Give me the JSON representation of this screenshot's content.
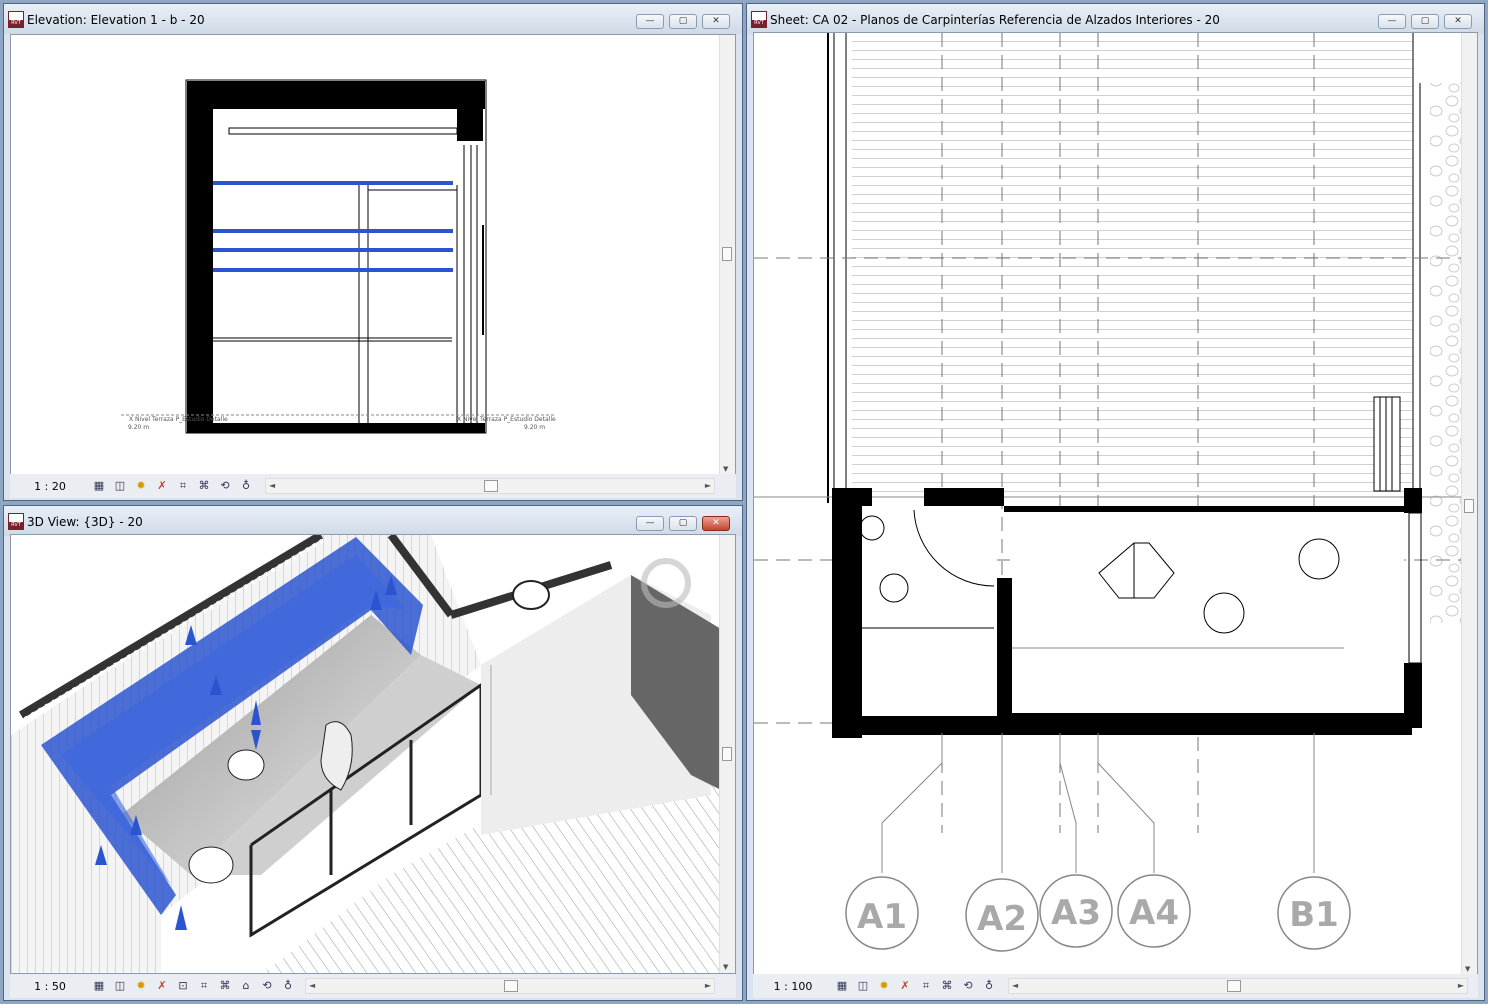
{
  "windows": {
    "elevation": {
      "title": "Elevation: Elevation 1 - b - 20",
      "scale": "1 : 20",
      "level_labels": [
        "X  Nivel Terraza P_Estudio Detalle",
        "X  Nivel Terraza P_Estudio Detalle"
      ],
      "level_values": [
        "9.20 m",
        "9.20 m"
      ]
    },
    "view3d": {
      "title": "3D View: {3D} - 20",
      "scale": "1 : 50"
    },
    "sheet": {
      "title": "Sheet: CA 02 - Planos  de Carpinterías Referencia de Alzados Interiores - 20",
      "scale": "1 : 100",
      "tags": [
        "A1",
        "A2",
        "A3",
        "A4",
        "B1"
      ]
    }
  },
  "window_buttons": {
    "minimize": "—",
    "restore": "▢",
    "close": "✕"
  },
  "view_control_icons": [
    "detail-level-icon",
    "visual-style-icon",
    "sun-path-icon",
    "shadows-icon",
    "crop-view-icon",
    "show-crop-icon",
    "temporary-hide-icon",
    "reveal-hidden-icon",
    "analysis-icon"
  ],
  "colors": {
    "selection_blue": "#2b55d0",
    "accent_red": "#c4442d"
  }
}
